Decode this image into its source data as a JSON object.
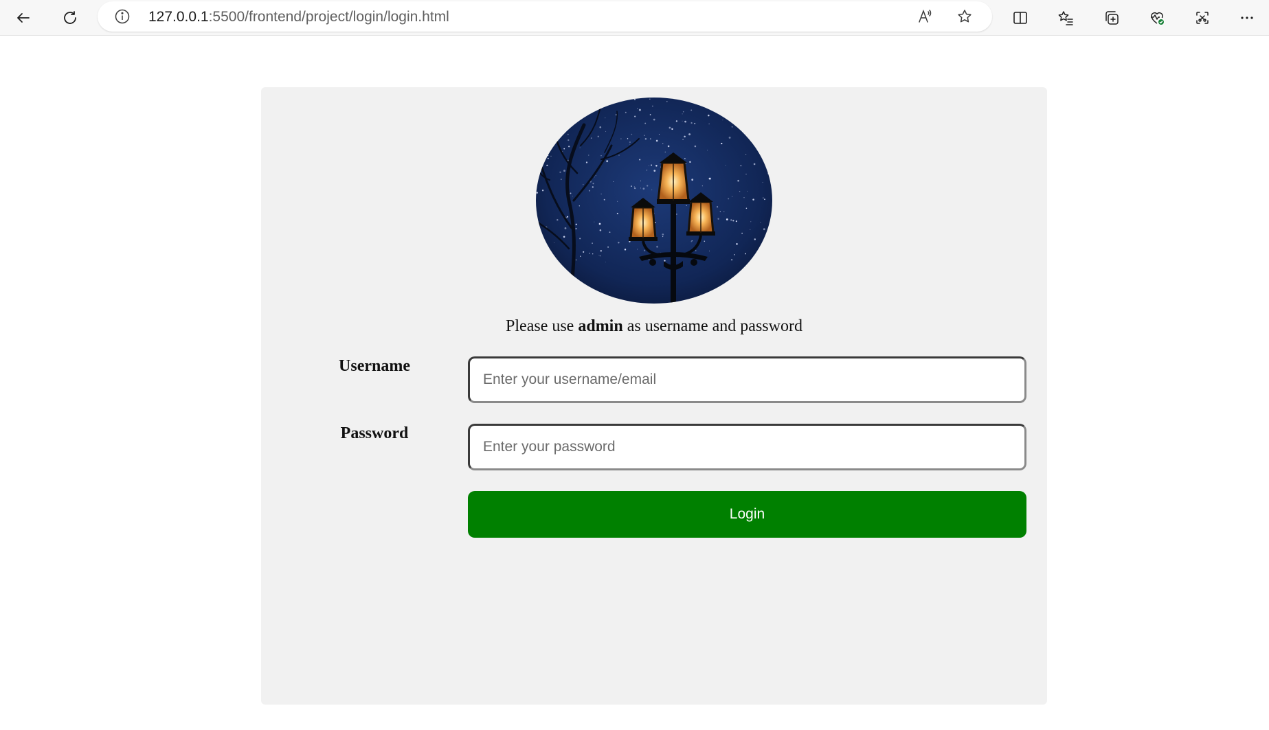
{
  "browser": {
    "url_host": "127.0.0.1",
    "url_path": ":5500/frontend/project/login/login.html"
  },
  "login": {
    "hint_prefix": "Please use ",
    "hint_bold": "admin",
    "hint_suffix": " as username and password",
    "username_label": "Username",
    "username_placeholder": "Enter your username/email",
    "password_label": "Password",
    "password_placeholder": "Enter your password",
    "button_label": "Login",
    "button_color": "#008000"
  },
  "icons": {
    "back": "arrow-left-icon",
    "refresh": "refresh-icon",
    "info": "info-icon",
    "read_aloud": "read-aloud-icon",
    "favorite": "star-icon",
    "split": "split-screen-icon",
    "favorites": "favorites-icon",
    "collections": "collections-icon",
    "health": "browser-essentials-icon",
    "screenshot": "web-capture-icon",
    "more": "more-icon"
  }
}
